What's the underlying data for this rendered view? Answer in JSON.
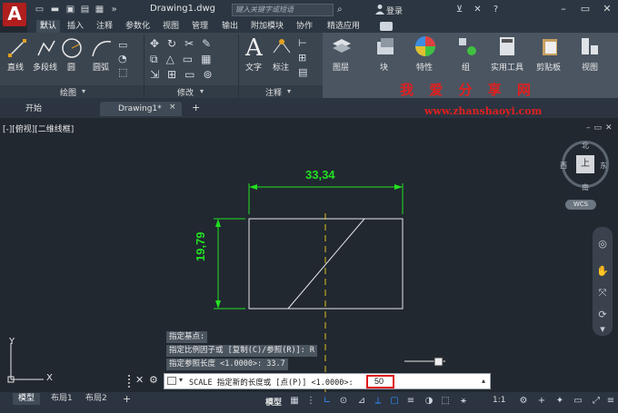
{
  "title_bar": {
    "app_logo": "A",
    "document_title": "Drawing1.dwg",
    "search_placeholder": "键入关键字或短语",
    "login_label": "登录"
  },
  "menu": {
    "items": [
      "默认",
      "插入",
      "注释",
      "参数化",
      "视图",
      "管理",
      "输出",
      "附加模块",
      "协作",
      "精选应用"
    ],
    "active_index": 0
  },
  "ribbon": {
    "draw_tools": [
      "直线",
      "多段线",
      "圆",
      "圆弧"
    ],
    "text_tools": [
      "文字",
      "标注"
    ],
    "big_tools": [
      "图层",
      "块",
      "特性",
      "组",
      "实用工具",
      "剪贴板",
      "视图"
    ],
    "panel_labels": [
      "绘图",
      "修改",
      "注释"
    ]
  },
  "watermark": {
    "text": "我 爱 分 享 网",
    "url": "www.zhanshaoyi.com"
  },
  "file_tabs": {
    "start_label": "开始",
    "drawing_label": "Drawing1*",
    "close_glyph": "×",
    "add_glyph": "+"
  },
  "viewport": {
    "label": "[-][俯视][二维线框]"
  },
  "drawing": {
    "dim_horizontal": "33,34",
    "dim_vertical": "19,79"
  },
  "viewcube": {
    "north": "北",
    "south": "南",
    "east": "东",
    "west": "西",
    "face": "上",
    "wcs": "WCS"
  },
  "ucs": {
    "x_label": "X",
    "y_label": "Y"
  },
  "command_history": [
    "指定基点:",
    "指定比例因子或 [复制(C)/参照(R)]: R",
    "指定参照长度 <1.0000>: 33.7"
  ],
  "command_line": {
    "prompt": "SCALE 指定新的长度或 [点(P)] <1.0000>:",
    "input_value": "50"
  },
  "layout_tabs": [
    "模型",
    "布局1",
    "布局2"
  ],
  "status_bar": {
    "model_label": "模型",
    "scale_label": "1:1"
  },
  "colors": {
    "dimension": "#22e022",
    "accent_red": "#e01818",
    "ribbon_bg": "#3b4550"
  }
}
